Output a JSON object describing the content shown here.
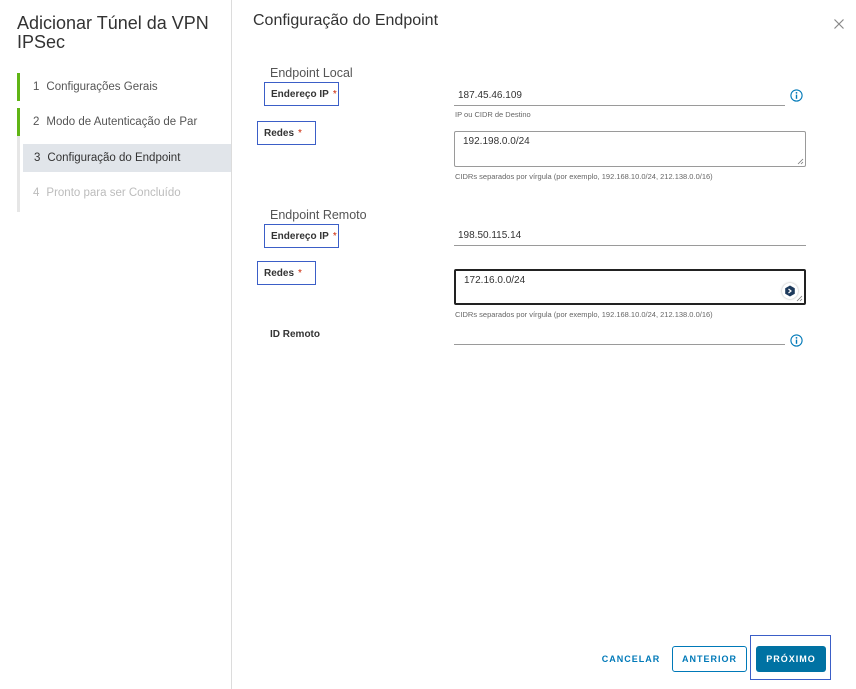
{
  "wizard": {
    "title": "Adicionar Túnel da VPN IPSec",
    "steps": [
      {
        "num": "1",
        "label": "Configurações Gerais",
        "state": "done"
      },
      {
        "num": "2",
        "label": "Modo de Autenticação de Par",
        "state": "done"
      },
      {
        "num": "3",
        "label": "Configuração do Endpoint",
        "state": "active"
      },
      {
        "num": "4",
        "label": "Pronto para ser Concluído",
        "state": "disabled"
      }
    ]
  },
  "page": {
    "title": "Configuração do Endpoint"
  },
  "local": {
    "section_title": "Endpoint Local",
    "ip_label": "Endereço IP",
    "ip_value": "187.45.46.109",
    "ip_helper": "IP ou CIDR de Destino",
    "networks_label": "Redes",
    "networks_value": "192.198.0.0/24",
    "networks_helper": "CIDRs separados por vírgula (por exemplo, 192.168.10.0/24, 212.138.0.0/16)"
  },
  "remote": {
    "section_title": "Endpoint Remoto",
    "ip_label": "Endereço IP",
    "ip_value": "198.50.115.14",
    "networks_label": "Redes",
    "networks_value": "172.16.0.0/24",
    "networks_helper": "CIDRs separados por vírgula (por exemplo, 192.168.10.0/24, 212.138.0.0/16)",
    "remote_id_label": "ID Remoto",
    "remote_id_value": ""
  },
  "required_mark": "*",
  "footer": {
    "cancel_label": "CANCELAR",
    "previous_label": "ANTERIOR",
    "next_label": "PRÓXIMO"
  },
  "colors": {
    "accent": "#0079b8",
    "primary_button": "#0072a3",
    "step_done": "#60b515",
    "active_step_bg": "#e1e5ea",
    "required": "#c92100",
    "highlight_outline": "#3b5ec7"
  }
}
